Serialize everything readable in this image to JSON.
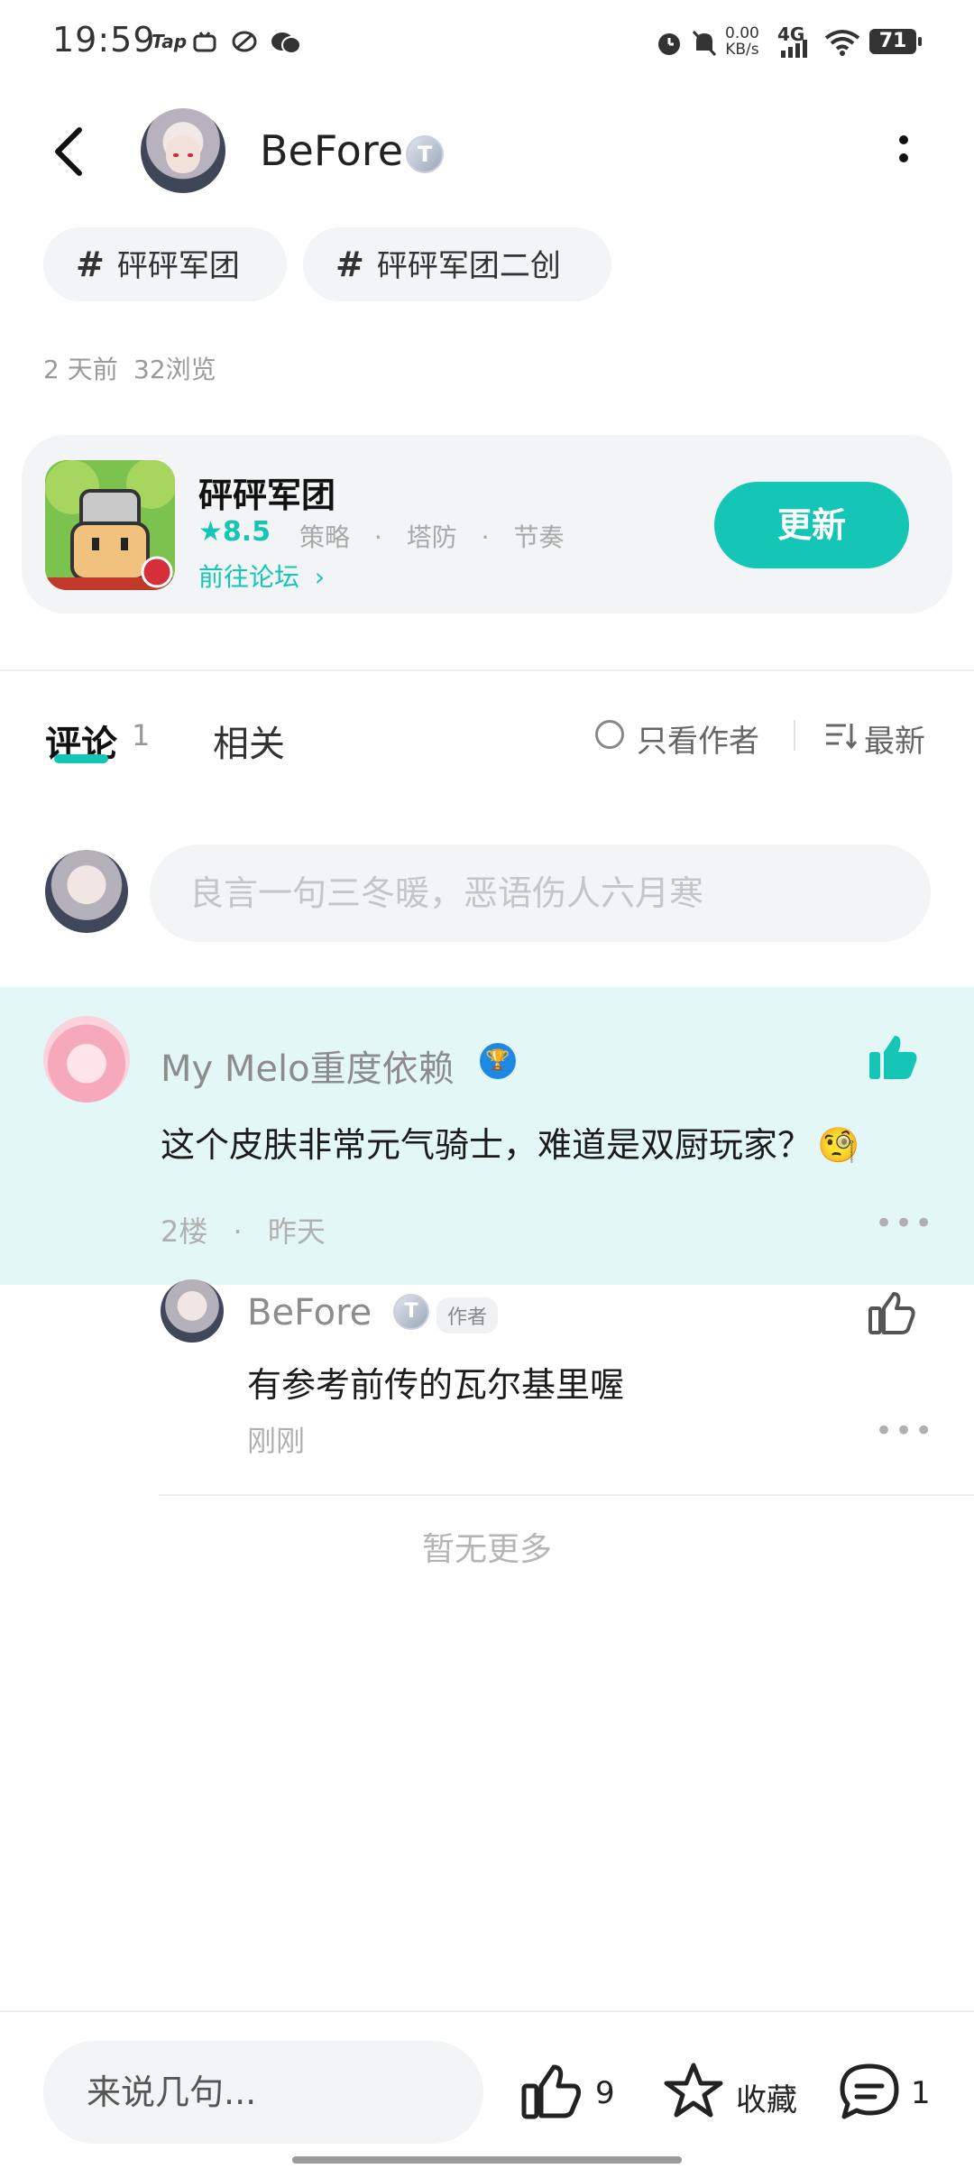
{
  "status_bar": {
    "time": "19:59",
    "app_icons": [
      "Tap",
      "bilibili-icon",
      "sync-icon",
      "wechat-icon"
    ],
    "speed_value": "0.00",
    "speed_unit": "KB/s",
    "network": "4G",
    "battery": "71"
  },
  "header": {
    "author_name": "BeFore",
    "badge": "T"
  },
  "topics": [
    {
      "label": "砰砰军团"
    },
    {
      "label": "砰砰军团二创"
    }
  ],
  "post_meta": {
    "age": "2 天前",
    "views": "32浏览"
  },
  "game_card": {
    "title": "砰砰军团",
    "rating": "8.5",
    "tags": [
      "策略",
      "塔防",
      "节奏"
    ],
    "forum_link": "前往论坛",
    "update_button": "更新"
  },
  "tabs": {
    "comments_label": "评论",
    "comments_count": "1",
    "related_label": "相关",
    "author_only": "只看作者",
    "sort": "最新"
  },
  "comment_input": {
    "placeholder": "良言一句三冬暖，恶语伤人六月寒"
  },
  "comments": [
    {
      "user": "My Melo重度依赖",
      "text": "这个皮肤非常元气骑士，难道是双厨玩家？",
      "emoji": "🧐",
      "floor": "2楼",
      "time": "昨天",
      "liked": true
    }
  ],
  "reply": {
    "user": "BeFore",
    "badge": "T",
    "tag": "作者",
    "text": "有参考前传的瓦尔基里喔",
    "time": "刚刚"
  },
  "no_more": "暂无更多",
  "bottom_bar": {
    "input_placeholder": "来说几句...",
    "likes": "9",
    "favorite": "收藏",
    "comments": "1"
  },
  "colors": {
    "accent": "#15c5b5",
    "highlight_bg": "#e3f8f6",
    "chip_bg": "#f2f4f5"
  }
}
